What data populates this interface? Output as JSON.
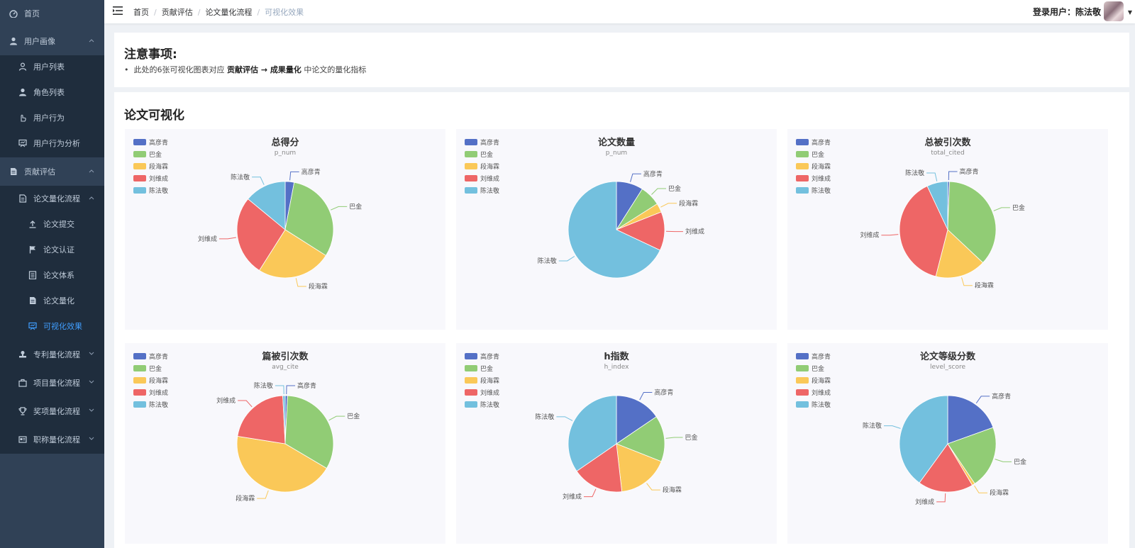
{
  "sidebar": {
    "items": [
      {
        "label": "首页",
        "icon": "dashboard-icon",
        "level": 0
      },
      {
        "label": "用户画像",
        "icon": "user-icon",
        "level": 0,
        "expanded": true
      },
      {
        "label": "用户列表",
        "icon": "user-outline-icon",
        "level": 1
      },
      {
        "label": "角色列表",
        "icon": "user-icon",
        "level": 1
      },
      {
        "label": "用户行为",
        "icon": "hand-pointer-icon",
        "level": 1
      },
      {
        "label": "用户行为分析",
        "icon": "chart-board-icon",
        "level": 1
      },
      {
        "label": "贡献评估",
        "icon": "document-icon",
        "level": 0,
        "expanded": true
      },
      {
        "label": "论文量化流程",
        "icon": "file-icon",
        "level": 1,
        "expanded": true
      },
      {
        "label": "论文提交",
        "icon": "upload-icon",
        "level": 2
      },
      {
        "label": "论文认证",
        "icon": "flag-icon",
        "level": 2
      },
      {
        "label": "论文体系",
        "icon": "list-icon",
        "level": 2
      },
      {
        "label": "论文量化",
        "icon": "document-icon",
        "level": 2
      },
      {
        "label": "可视化效果",
        "icon": "chart-board-icon",
        "level": 2,
        "active": true
      },
      {
        "label": "专利量化流程",
        "icon": "stamp-icon",
        "level": 1
      },
      {
        "label": "项目量化流程",
        "icon": "briefcase-icon",
        "level": 1
      },
      {
        "label": "奖项量化流程",
        "icon": "trophy-icon",
        "level": 1
      },
      {
        "label": "职称量化流程",
        "icon": "id-card-icon",
        "level": 1
      }
    ]
  },
  "header": {
    "breadcrumb": [
      "首页",
      "贡献评估",
      "论文量化流程",
      "可视化效果"
    ],
    "user_label": "登录用户：陈法敬"
  },
  "notice": {
    "title": "注意事项:",
    "prefix": "此处的6张可视化图表对应 ",
    "bold1": "贡献评估",
    "arrow": " → ",
    "bold2": "成果量化",
    "suffix": " 中论文的量化指标"
  },
  "section": {
    "title": "论文可视化"
  },
  "colors": {
    "高彦青": "#5470c6",
    "巴金": "#91cc75",
    "段海霖": "#fac858",
    "刘维成": "#ee6666",
    "陈法敬": "#73c0de",
    "sidebar_bg": "#304156",
    "accent": "#409eff"
  },
  "chart_data": [
    {
      "type": "pie",
      "title": "总得分",
      "subtitle": "p_num",
      "categories": [
        "高彦青",
        "巴金",
        "段海霖",
        "刘维成",
        "陈法敬"
      ],
      "values": [
        3,
        31,
        25,
        27,
        14
      ]
    },
    {
      "type": "pie",
      "title": "论文数量",
      "subtitle": "p_num",
      "categories": [
        "高彦青",
        "巴金",
        "段海霖",
        "刘维成",
        "陈法敬"
      ],
      "values": [
        9,
        7,
        3,
        13,
        68
      ]
    },
    {
      "type": "pie",
      "title": "总被引次数",
      "subtitle": "total_cited",
      "categories": [
        "高彦青",
        "巴金",
        "段海霖",
        "刘维成",
        "陈法敬"
      ],
      "values": [
        0.6,
        36.4,
        17,
        39,
        7
      ]
    },
    {
      "type": "pie",
      "title": "篇被引次数",
      "subtitle": "avg_cite",
      "categories": [
        "高彦青",
        "巴金",
        "段海霖",
        "刘维成",
        "陈法敬"
      ],
      "values": [
        0.8,
        32.7,
        44,
        21.7,
        0.8
      ]
    },
    {
      "type": "pie",
      "title": "h指数",
      "subtitle": "h_index",
      "categories": [
        "高彦青",
        "巴金",
        "段海霖",
        "刘维成",
        "陈法敬"
      ],
      "values": [
        15.5,
        15.5,
        17.2,
        17.2,
        34.6
      ]
    },
    {
      "type": "pie",
      "title": "论文等级分数",
      "subtitle": "level_score",
      "categories": [
        "高彦青",
        "巴金",
        "段海霖",
        "刘维成",
        "陈法敬"
      ],
      "values": [
        19.5,
        21,
        1,
        18.5,
        40
      ]
    }
  ]
}
